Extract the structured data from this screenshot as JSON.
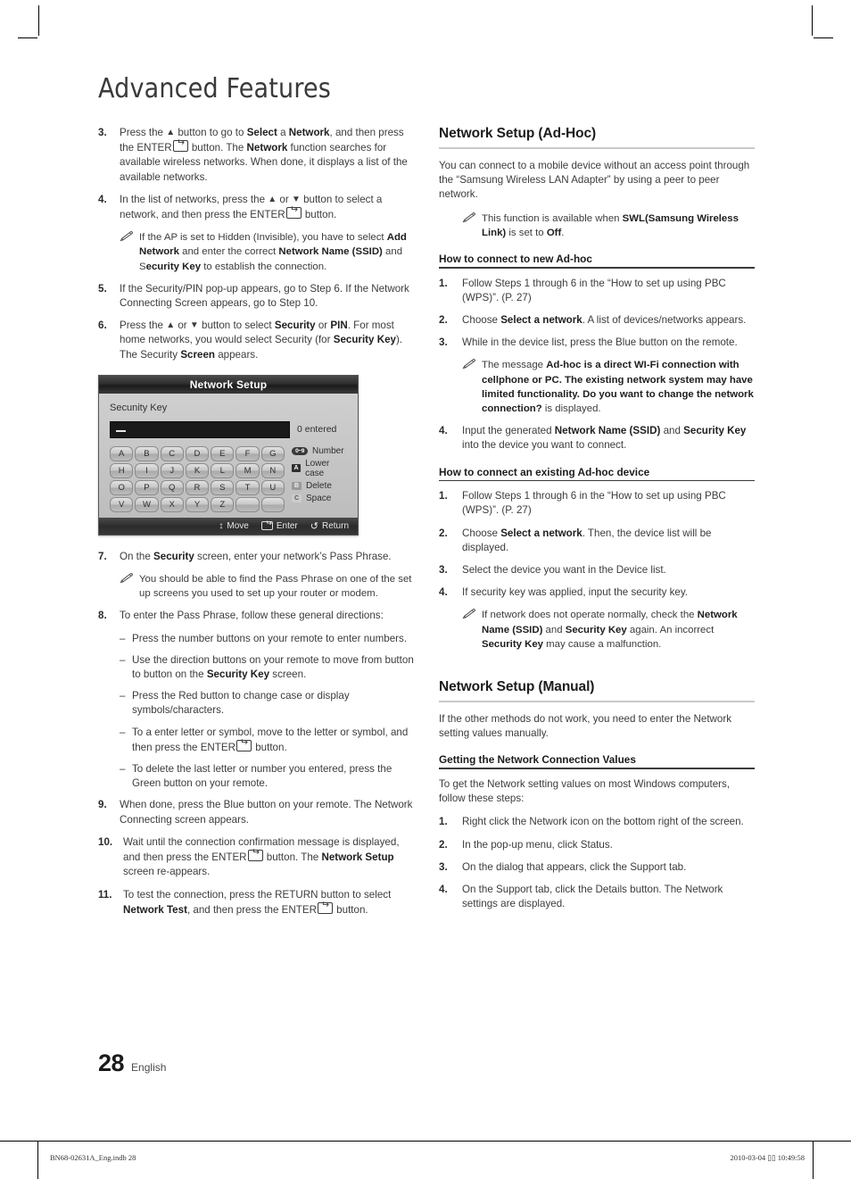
{
  "chapter_title": "Advanced Features",
  "left_column": {
    "steps": [
      {
        "num": "3.",
        "parts": [
          {
            "t": "Press the "
          },
          {
            "t": "▲",
            "s": "arrow"
          },
          {
            "t": " button to go to "
          },
          {
            "t": "Select",
            "s": "b"
          },
          {
            "t": " a "
          },
          {
            "t": "Network",
            "s": "b"
          },
          {
            "t": ", and then press the ENTER"
          },
          {
            "t": "ENTERKEY",
            "s": "key"
          },
          {
            "t": " button. The "
          },
          {
            "t": "Network",
            "s": "b"
          },
          {
            "t": " function searches for available wireless networks. When done, it displays a list of the available networks."
          }
        ]
      },
      {
        "num": "4.",
        "parts": [
          {
            "t": "In the list of networks, press the "
          },
          {
            "t": "▲",
            "s": "arrow"
          },
          {
            "t": " or "
          },
          {
            "t": "▼",
            "s": "arrow"
          },
          {
            "t": " button to select a network, and then press the ENTER"
          },
          {
            "t": "ENTERKEY",
            "s": "key"
          },
          {
            "t": " button."
          }
        ]
      }
    ],
    "note_4": [
      {
        "t": "If the AP is set to Hidden (Invisible), you have to select "
      },
      {
        "t": "Add Network",
        "s": "b"
      },
      {
        "t": " and enter the correct "
      },
      {
        "t": "Network Name (SSID)",
        "s": "b"
      },
      {
        "t": " and S"
      },
      {
        "t": "ecurity Key",
        "s": "b"
      },
      {
        "t": " to establish the connection."
      }
    ],
    "steps_5_6": [
      {
        "num": "5.",
        "parts": [
          {
            "t": "If the Security/PIN pop-up appears, go to Step 6. If the Network Connecting Screen appears, go to Step 10."
          }
        ]
      },
      {
        "num": "6.",
        "parts": [
          {
            "t": "Press the "
          },
          {
            "t": "▲",
            "s": "arrow"
          },
          {
            "t": " or "
          },
          {
            "t": "▼",
            "s": "arrow"
          },
          {
            "t": " button to select "
          },
          {
            "t": "Security",
            "s": "b"
          },
          {
            "t": " or "
          },
          {
            "t": "PIN",
            "s": "b"
          },
          {
            "t": ". For most home networks, you would select Security (for "
          },
          {
            "t": "Security Key",
            "s": "b"
          },
          {
            "t": "). The Security "
          },
          {
            "t": "Screen",
            "s": "b"
          },
          {
            "t": " appears."
          }
        ]
      }
    ],
    "step_7": {
      "num": "7.",
      "parts": [
        {
          "t": "On the "
        },
        {
          "t": "Security",
          "s": "b"
        },
        {
          "t": " screen, enter your network’s Pass Phrase."
        }
      ]
    },
    "note_7": [
      {
        "t": "You should be able to find the Pass Phrase on one of the set up screens you used to set up your router or modem."
      }
    ],
    "step_8": {
      "num": "8.",
      "parts": [
        {
          "t": "To enter the Pass Phrase, follow these general directions:"
        }
      ]
    },
    "dashes": [
      [
        {
          "t": "Press the number buttons on your remote to enter numbers."
        }
      ],
      [
        {
          "t": "Use the direction buttons on your remote to move from button to button on the "
        },
        {
          "t": "Security Key",
          "s": "b"
        },
        {
          "t": " screen."
        }
      ],
      [
        {
          "t": "Press the Red button to change case or display symbols/characters."
        }
      ],
      [
        {
          "t": "To a enter letter or symbol, move to the letter or symbol, and then press the ENTER"
        },
        {
          "t": "ENTERKEY",
          "s": "key"
        },
        {
          "t": " button."
        }
      ],
      [
        {
          "t": "To delete the last letter or number you entered, press the Green button on your remote."
        }
      ]
    ],
    "steps_9_11": [
      {
        "num": "9.",
        "parts": [
          {
            "t": "When done, press the Blue button on your remote. The Network Connecting screen appears."
          }
        ]
      },
      {
        "num": "10.",
        "parts": [
          {
            "t": "Wait until the connection confirmation message is displayed, and then press the ENTER"
          },
          {
            "t": "ENTERKEY",
            "s": "key"
          },
          {
            "t": " button. The "
          },
          {
            "t": "Network Setup",
            "s": "b"
          },
          {
            "t": " screen re-appears."
          }
        ]
      },
      {
        "num": "11.",
        "parts": [
          {
            "t": "To test the connection, press the RETURN button to select "
          },
          {
            "t": "Network Test",
            "s": "b"
          },
          {
            "t": ", and then press the ENTER"
          },
          {
            "t": "ENTERKEY",
            "s": "key"
          },
          {
            "t": " button."
          }
        ]
      }
    ]
  },
  "osd": {
    "title": "Network Setup",
    "field_label": "Secunity Key",
    "entered_count": "0 entered",
    "keys": [
      "A",
      "B",
      "C",
      "D",
      "E",
      "F",
      "G",
      "H",
      "I",
      "J",
      "K",
      "L",
      "M",
      "N",
      "O",
      "P",
      "Q",
      "R",
      "S",
      "T",
      "U",
      "V",
      "W",
      "X",
      "Y",
      "Z",
      "",
      ""
    ],
    "legend": [
      {
        "chip": "0~9",
        "chip_type": "num",
        "label": "Number"
      },
      {
        "chip": "A",
        "chip_type": "a",
        "label": "Lower case"
      },
      {
        "chip": "B",
        "chip_type": "b",
        "label": "Delete"
      },
      {
        "chip": "C",
        "chip_type": "c",
        "label": "Space"
      }
    ],
    "footer": [
      {
        "icon": "up-down-arrow-icon",
        "label": "Move"
      },
      {
        "icon": "enter-key-icon",
        "label": "Enter"
      },
      {
        "icon": "return-arrow-icon",
        "label": "Return"
      }
    ]
  },
  "right_column": {
    "adhoc": {
      "heading": "Network Setup (Ad-Hoc)",
      "intro": "You can connect to a mobile device without an access point through the “Samsung Wireless LAN Adapter” by using a peer to peer network.",
      "note": [
        {
          "t": "This function is available when "
        },
        {
          "t": "SWL(Samsung Wireless Link)",
          "s": "b"
        },
        {
          "t": " is set to "
        },
        {
          "t": "Off",
          "s": "b"
        },
        {
          "t": "."
        }
      ],
      "sub1_heading": "How to connect to new Ad-hoc",
      "sub1_steps": [
        {
          "num": "1.",
          "parts": [
            {
              "t": "Follow Steps 1 through 6 in the “How to set up using PBC (WPS)”. (P. 27)"
            }
          ]
        },
        {
          "num": "2.",
          "parts": [
            {
              "t": "Choose "
            },
            {
              "t": "Select a network",
              "s": "b"
            },
            {
              "t": ". A list of devices/networks appears."
            }
          ]
        },
        {
          "num": "3.",
          "parts": [
            {
              "t": "While in the device list, press the Blue button on the remote."
            }
          ]
        }
      ],
      "sub1_note": [
        {
          "t": "The message "
        },
        {
          "t": "Ad-hoc is a direct WI-Fi connection with cellphone or PC. The existing network system may have limited functionality. Do you want to change the network connection?",
          "s": "b"
        },
        {
          "t": " is displayed."
        }
      ],
      "sub1_step4": {
        "num": "4.",
        "parts": [
          {
            "t": "Input the generated "
          },
          {
            "t": "Network Name (SSID)",
            "s": "b"
          },
          {
            "t": " and "
          },
          {
            "t": "Security Key",
            "s": "b"
          },
          {
            "t": " into the device you want to connect."
          }
        ]
      },
      "sub2_heading": "How to connect an existing Ad-hoc device",
      "sub2_steps": [
        {
          "num": "1.",
          "parts": [
            {
              "t": "Follow Steps 1 through 6 in the “How to set up using PBC (WPS)”. (P. 27)"
            }
          ]
        },
        {
          "num": "2.",
          "parts": [
            {
              "t": "Choose "
            },
            {
              "t": "Select a network",
              "s": "b"
            },
            {
              "t": ". Then, the device list will be displayed."
            }
          ]
        },
        {
          "num": "3.",
          "parts": [
            {
              "t": "Select the device you want in the Device list."
            }
          ]
        },
        {
          "num": "4.",
          "parts": [
            {
              "t": "If security key was applied, input the security key."
            }
          ]
        }
      ],
      "sub2_note": [
        {
          "t": "If network does not operate normally, check the "
        },
        {
          "t": "Network Name (SSID)",
          "s": "b"
        },
        {
          "t": " and "
        },
        {
          "t": "Security Key",
          "s": "b"
        },
        {
          "t": " again. An incorrect "
        },
        {
          "t": "Security Key",
          "s": "b"
        },
        {
          "t": " may cause a malfunction."
        }
      ]
    },
    "manual": {
      "heading": "Network Setup (Manual)",
      "intro": "If the other methods do not work, you need to enter the Network setting values manually.",
      "sub_heading": "Getting the Network Connection Values",
      "sub_intro": "To get the Network setting values on most Windows computers, follow these steps:",
      "steps": [
        {
          "num": "1.",
          "parts": [
            {
              "t": "Right click the Network icon on the bottom right of the screen."
            }
          ]
        },
        {
          "num": "2.",
          "parts": [
            {
              "t": "In the pop-up menu, click Status."
            }
          ]
        },
        {
          "num": "3.",
          "parts": [
            {
              "t": "On the dialog that appears, click the Support tab."
            }
          ]
        },
        {
          "num": "4.",
          "parts": [
            {
              "t": "On the Support tab, click the Details button. The Network settings are displayed."
            }
          ]
        }
      ]
    }
  },
  "footer": {
    "page_number": "28",
    "language": "English",
    "print_left": "BN68-02631A_Eng.indb   28",
    "print_right": "2010-03-04   ▯▯ 10:49:58"
  }
}
